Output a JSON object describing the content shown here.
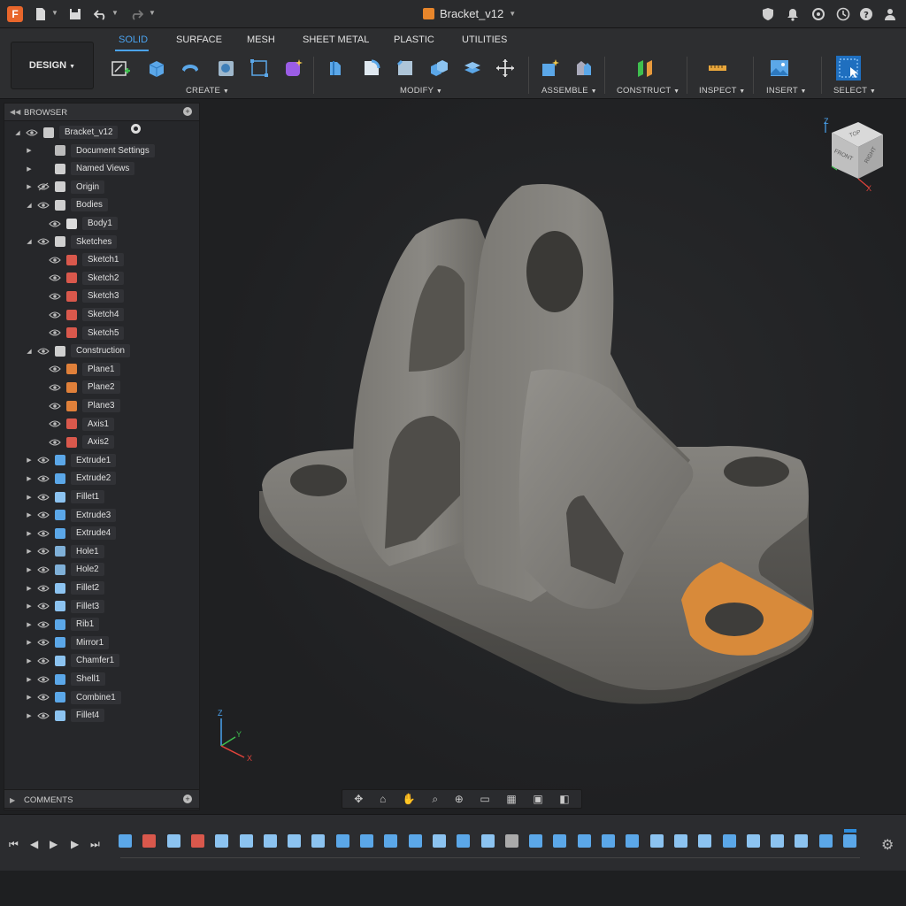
{
  "app": {
    "logo_letter": "F",
    "document_title": "Bracket_v12"
  },
  "workspace": {
    "label": "DESIGN"
  },
  "tabs": [
    "SOLID",
    "SURFACE",
    "MESH",
    "SHEET METAL",
    "PLASTIC",
    "UTILITIES"
  ],
  "active_tab": "SOLID",
  "groups": [
    "CREATE",
    "MODIFY",
    "ASSEMBLE",
    "CONSTRUCT",
    "INSPECT",
    "INSERT",
    "SELECT"
  ],
  "browser": {
    "title": "BROWSER",
    "nodes": [
      {
        "label": "Bracket_v12",
        "icon": "document-icon"
      },
      {
        "label": "Document Settings",
        "icon": "gear-icon"
      },
      {
        "label": "Named Views",
        "icon": "folder-icon"
      },
      {
        "label": "Origin",
        "icon": "folder-icon"
      },
      {
        "label": "Bodies",
        "icon": "folder-icon"
      },
      {
        "label": "Body1",
        "icon": "body-icon"
      },
      {
        "label": "Sketches",
        "icon": "folder-icon"
      },
      {
        "label": "Sketch1",
        "icon": "sketch-icon"
      },
      {
        "label": "Sketch2",
        "icon": "sketch-icon"
      },
      {
        "label": "Sketch3",
        "icon": "sketch-icon"
      },
      {
        "label": "Sketch4",
        "icon": "sketch-icon"
      },
      {
        "label": "Sketch5",
        "icon": "sketch-icon"
      },
      {
        "label": "Construction",
        "icon": "folder-icon"
      },
      {
        "label": "Plane1",
        "icon": "plane-icon"
      },
      {
        "label": "Plane2",
        "icon": "plane-icon"
      },
      {
        "label": "Plane3",
        "icon": "plane-icon"
      },
      {
        "label": "Axis1",
        "icon": "axis-icon"
      },
      {
        "label": "Axis2",
        "icon": "axis-icon"
      },
      {
        "label": "Extrude1",
        "icon": "extrude-icon"
      },
      {
        "label": "Extrude2",
        "icon": "extrude-icon"
      },
      {
        "label": "Fillet1",
        "icon": "fillet-icon"
      },
      {
        "label": "Extrude3",
        "icon": "extrude-icon"
      },
      {
        "label": "Extrude4",
        "icon": "extrude-icon"
      },
      {
        "label": "Hole1",
        "icon": "hole-icon"
      },
      {
        "label": "Hole2",
        "icon": "hole-icon"
      },
      {
        "label": "Fillet2",
        "icon": "fillet-icon"
      },
      {
        "label": "Fillet3",
        "icon": "fillet-icon"
      },
      {
        "label": "Rib1",
        "icon": "rib-icon"
      },
      {
        "label": "Mirror1",
        "icon": "mirror-icon"
      },
      {
        "label": "Chamfer1",
        "icon": "chamfer-icon"
      },
      {
        "label": "Shell1",
        "icon": "shell-icon"
      },
      {
        "label": "Combine1",
        "icon": "combine-icon"
      },
      {
        "label": "Fillet4",
        "icon": "fillet-icon"
      }
    ]
  },
  "comments": {
    "title": "COMMENTS"
  },
  "viewcube": {
    "top": "TOP",
    "front": "FRONT",
    "right": "RIGHT",
    "axis_z": "Z",
    "axis_x": "X"
  },
  "triad": {
    "z": "Z",
    "y": "Y",
    "x": "X"
  },
  "colors": {
    "accent": "#4aa3f0",
    "selected_face": "#d88a3a",
    "model": "#6f6d69",
    "logo": "#e8662b"
  }
}
